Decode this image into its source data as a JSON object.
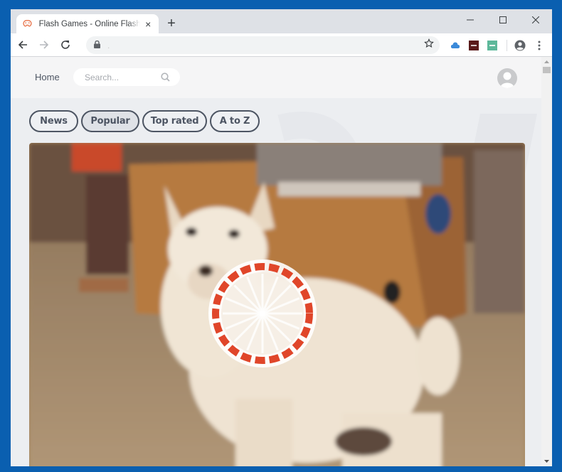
{
  "browser": {
    "tab": {
      "title": "Flash Games - Online Flash Games",
      "favicon": "gamepad-icon",
      "close_icon": "close-icon"
    },
    "new_tab_icon": "plus-icon",
    "window_controls": [
      "minimize-icon",
      "maximize-icon",
      "close-icon"
    ],
    "toolbar": {
      "back_icon": "arrow-left-icon",
      "forward_icon": "arrow-right-icon",
      "reload_icon": "reload-icon",
      "lock_icon": "lock-icon",
      "url": ".",
      "bookmark_icon": "star-icon",
      "extensions": [
        {
          "name": "cloud-extension-icon",
          "color": "#3b8ad9"
        },
        {
          "name": "dark-red-extension-icon",
          "color": "#5a1a1a"
        },
        {
          "name": "teal-extension-icon",
          "color": "#5db89a"
        }
      ],
      "profile_icon": "account-circle-icon",
      "menu_icon": "kebab-menu-icon"
    }
  },
  "page": {
    "header": {
      "home_label": "Home",
      "search": {
        "placeholder": "Search...",
        "value": ""
      },
      "avatar_icon": "user-avatar-icon"
    },
    "filters": [
      {
        "label": "News",
        "active": false
      },
      {
        "label": "Popular",
        "active": true
      },
      {
        "label": "Top rated",
        "active": false
      },
      {
        "label": "A to Z",
        "active": false
      }
    ],
    "hero": {
      "image": "white dog sitting in front of cardboard box",
      "overlay": "loading-spinner"
    }
  },
  "colors": {
    "window_frame": "#0a5fb0",
    "pill_border": "#4d5563",
    "spinner_red": "#e0462a"
  }
}
